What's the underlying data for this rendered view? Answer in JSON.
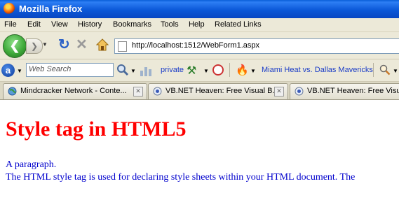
{
  "window": {
    "title": "Mozilla Firefox"
  },
  "menu": [
    "File",
    "Edit",
    "View",
    "History",
    "Bookmarks",
    "Tools",
    "Help",
    "Related Links"
  ],
  "navigation": {
    "url": "http://localhost:1512/WebForm1.aspx"
  },
  "toolbar": {
    "search_placeholder": "Web Search",
    "private_label": "private",
    "bookmark_link": "Miami Heat vs. Dallas Mavericks"
  },
  "tabs": [
    {
      "label": "Mindcracker Network - Conte..."
    },
    {
      "label": "VB.NET Heaven: Free Visual B..."
    },
    {
      "label": "VB.NET Heaven: Free Visual B"
    }
  ],
  "page": {
    "heading": "Style tag in HTML5",
    "paragraph1": "A paragraph.",
    "paragraph2": "The HTML style tag is used for declaring style sheets within your HTML document. The"
  },
  "colors": {
    "heading": "#ff0000",
    "paragraph": "#0000cd",
    "titlebar": "#0b58d8"
  }
}
